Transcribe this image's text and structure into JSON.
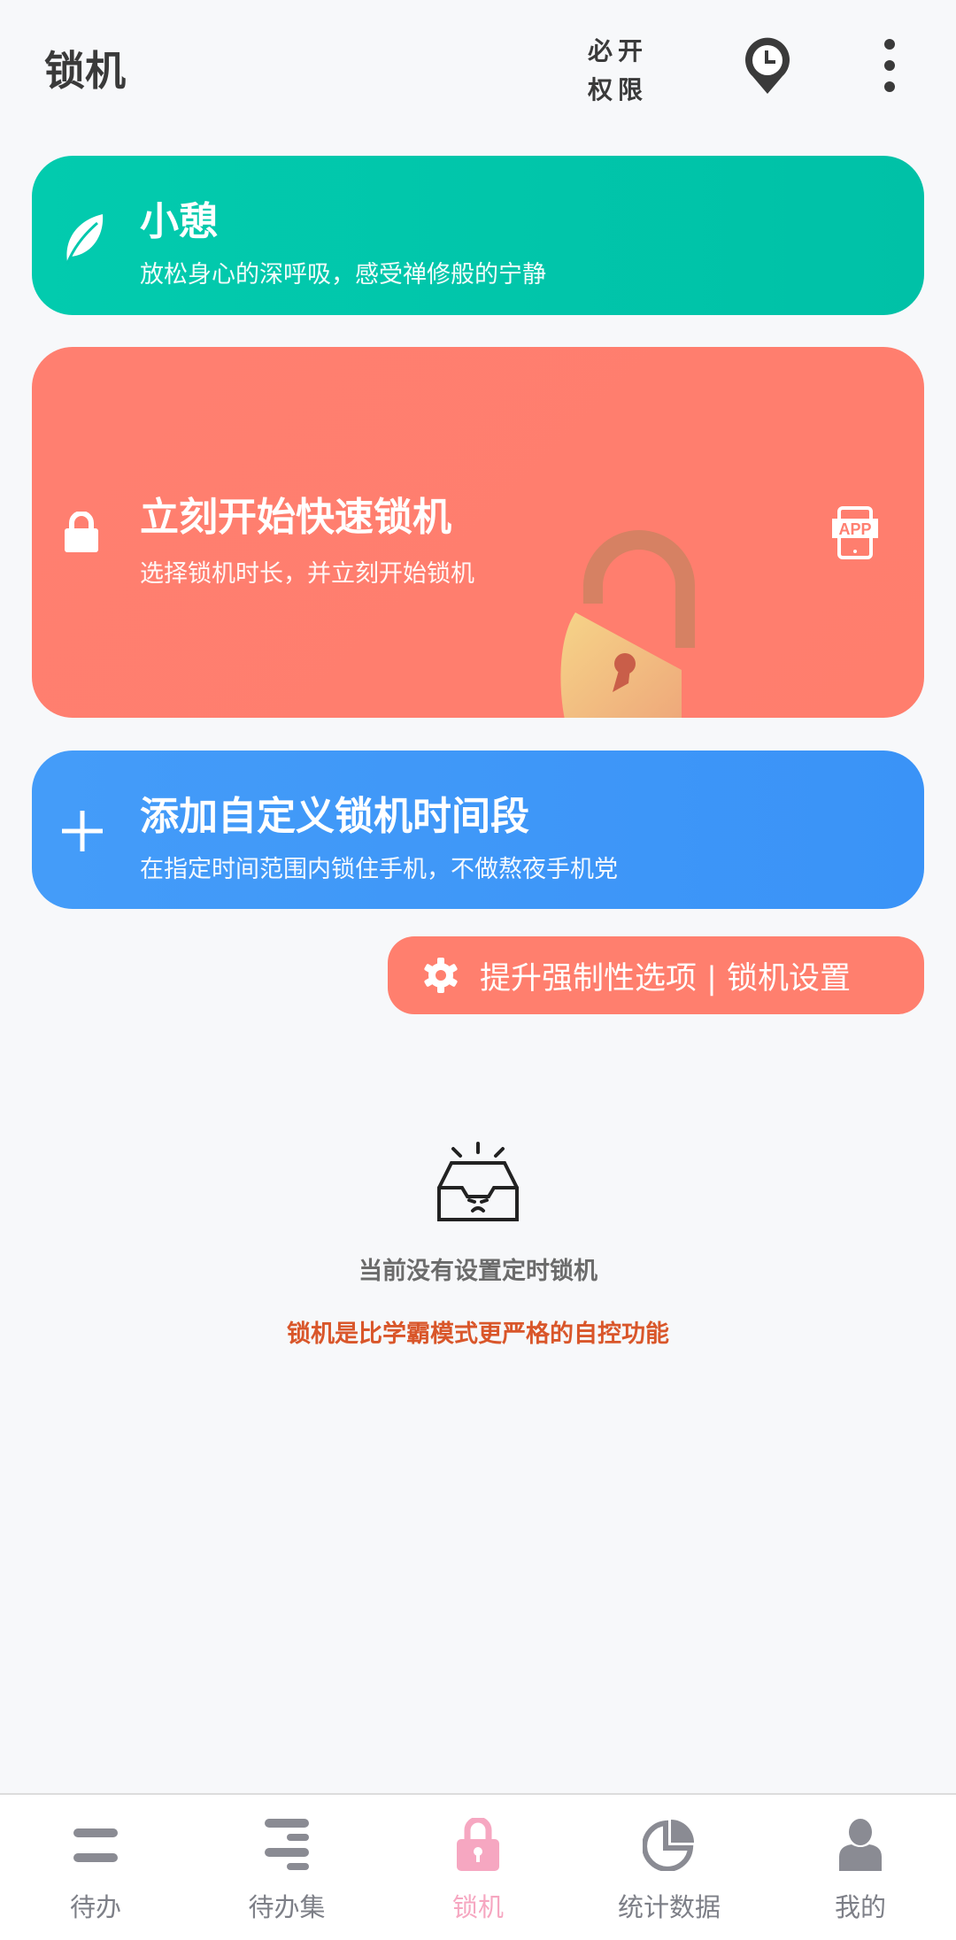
{
  "header": {
    "title": "锁机",
    "permissions_label_line1": "必开",
    "permissions_label_line2": "权限",
    "icons": [
      "clock-pin-icon",
      "more-vertical-icon"
    ]
  },
  "cards": [
    {
      "title": "小憩",
      "subtitle": "放松身心的深呼吸，感受禅修般的宁静",
      "icon": "leaf-icon",
      "color": "#02c8ad"
    },
    {
      "title": "立刻开始快速锁机",
      "subtitle": "选择锁机时长，并立刻开始锁机",
      "icon": "lock-icon",
      "right_icon": "app-phone-icon",
      "color": "#ff7f70"
    },
    {
      "title": "添加自定义锁机时间段",
      "subtitle": "在指定时间范围内锁住手机，不做熬夜手机党",
      "icon": "plus-icon",
      "color": "#4099f8"
    }
  ],
  "settings_button": {
    "label": "提升强制性选项 | 锁机设置",
    "icon": "gear-icon"
  },
  "empty_state": {
    "icon": "empty-inbox-icon",
    "message": "当前没有设置定时锁机",
    "note": "锁机是比学霸模式更严格的自控功能"
  },
  "nav": {
    "items": [
      {
        "label": "待办",
        "icon": "two-lines-icon"
      },
      {
        "label": "待办集",
        "icon": "list-icon"
      },
      {
        "label": "锁机",
        "icon": "lock-icon",
        "active": true
      },
      {
        "label": "统计数据",
        "icon": "pie-chart-icon"
      },
      {
        "label": "我的",
        "icon": "user-icon"
      }
    ],
    "active_color": "#f6a7c1",
    "inactive_color": "#8a8b93"
  }
}
